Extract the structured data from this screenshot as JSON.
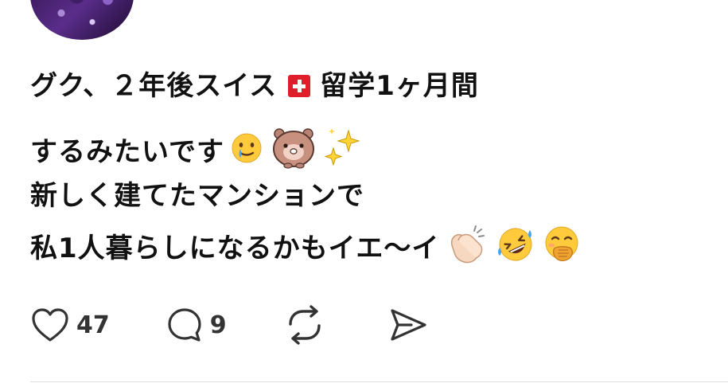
{
  "post": {
    "lines": [
      {
        "before_flag": "グク、２年後スイス",
        "after_flag": "留学1ヶ月間"
      },
      {
        "text": "するみたいです"
      },
      {
        "text": "新しく建てたマンションで"
      },
      {
        "text": "私1人暮らしになるかもイエ〜イ"
      }
    ],
    "emojis": [
      "crying-smile-emoji",
      "hamster-character-emoji",
      "sparkles-emoji",
      "clapping-hands-emoji",
      "rolling-laughing-emoji",
      "hand-over-mouth-emoji"
    ]
  },
  "actions": {
    "like_count": "47",
    "reply_count": "9"
  },
  "icons": {
    "like": "heart-icon",
    "reply": "comment-icon",
    "repost": "repost-icon",
    "share": "send-icon"
  },
  "colors": {
    "flag_red": "#e01e2b",
    "avatar_purple": "#5a2d8a",
    "text": "#111111",
    "icon": "#333333"
  }
}
